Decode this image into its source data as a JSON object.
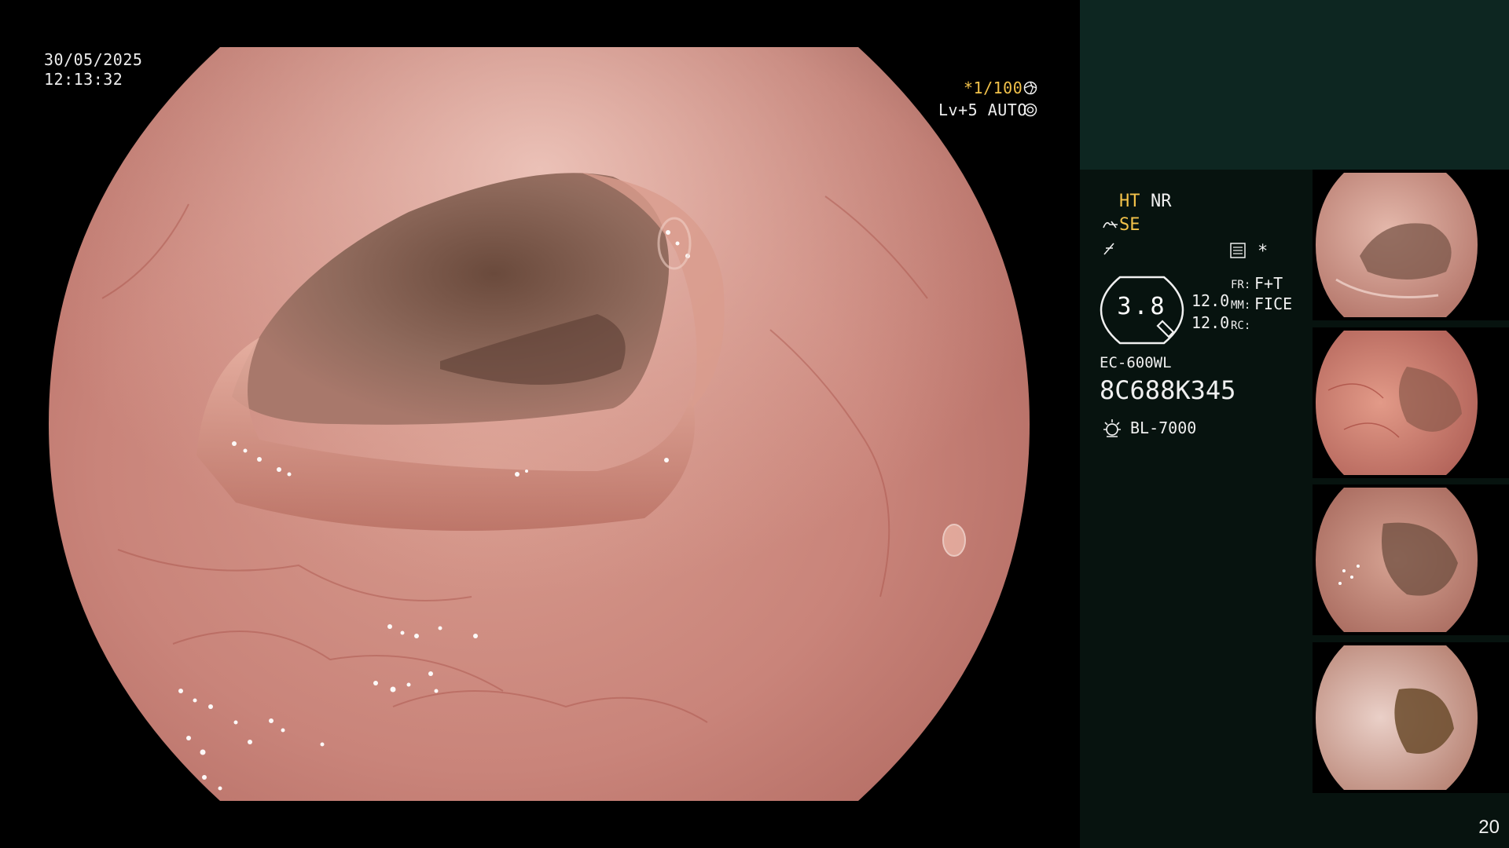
{
  "overlay": {
    "date": "30/05/2025",
    "time": "12:13:32",
    "shutter": "*1/100",
    "brightness": "Lv+5 AUTO"
  },
  "panel": {
    "ht_label": "HT",
    "nr_label": "NR",
    "se_label": "SE",
    "zoom": "3.8",
    "val_top": "12.0",
    "val_bottom": "12.0",
    "fr_key": "FR:",
    "fr_value": "F+T",
    "mm_key": "MM:",
    "mm_value": "FICE",
    "rc_key": "RC:",
    "scope_model": "EC-600WL",
    "serial": "8C688K345",
    "light_source": "BL-7000",
    "asterisk": "*"
  },
  "thumbnails": [
    {
      "id": "thumb-1"
    },
    {
      "id": "thumb-2"
    },
    {
      "id": "thumb-3"
    },
    {
      "id": "thumb-4"
    }
  ],
  "page_number": "20",
  "colors": {
    "panel_bg": "#07130f",
    "panel_top": "#0d2621",
    "accent_amber": "#f3c24a",
    "mucosa": "#c9847a"
  }
}
